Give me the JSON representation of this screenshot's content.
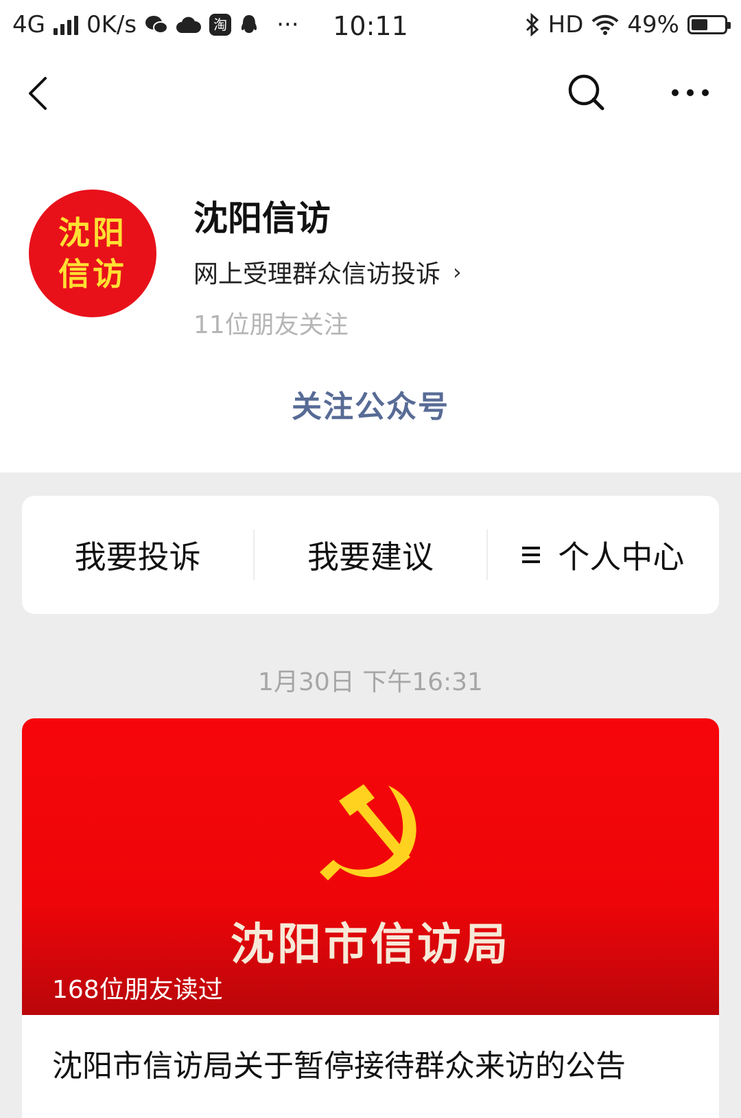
{
  "status_bar": {
    "network": "4G",
    "speed": "0K/s",
    "app_badge": "淘",
    "overflow": "···",
    "time": "10:11",
    "hd": "HD",
    "battery_text": "49%",
    "battery_level": 0.49
  },
  "nav": {
    "back_icon": "chevron-left-icon",
    "search_icon": "search-icon",
    "more_icon": "more-horizontal-icon"
  },
  "profile": {
    "avatar_line1": "沈阳",
    "avatar_line2": "信访",
    "name": "沈阳信访",
    "description": "网上受理群众信访投诉",
    "description_chevron": "›",
    "friends_following": "11位朋友关注",
    "follow_button": "关注公众号"
  },
  "menu": {
    "items": [
      {
        "label": "我要投诉"
      },
      {
        "label": "我要建议"
      },
      {
        "label": "个人中心",
        "icon": "list-icon"
      }
    ]
  },
  "feed": {
    "timestamp": "1月30日 下午16:31",
    "article": {
      "cover_title": "沈阳市信访局",
      "read_count": "168位朋友读过",
      "title": "沈阳市信访局关于暂停接待群众来访的公告"
    }
  },
  "colors": {
    "link_blue": "#576b95",
    "cover_red": "#ee0509",
    "emblem_yellow": "#ffd21f",
    "background_grey": "#ededed"
  }
}
